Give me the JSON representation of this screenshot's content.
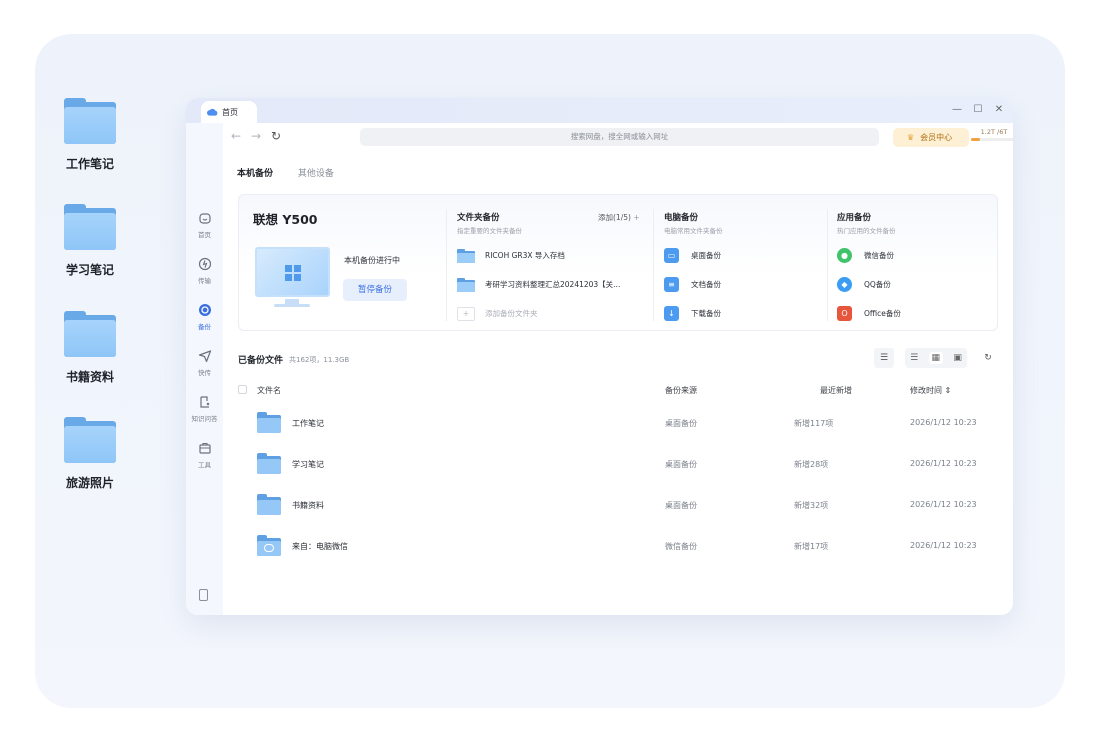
{
  "desktop": {
    "icons": [
      {
        "label": "工作笔记"
      },
      {
        "label": "学习笔记"
      },
      {
        "label": "书籍资料"
      },
      {
        "label": "旅游照片"
      }
    ]
  },
  "window": {
    "tab_title": "首页",
    "controls": {
      "minimize": "—",
      "maximize": "☐",
      "close": "✕"
    },
    "nav": {
      "back": "←",
      "forward": "→",
      "refresh": "↻"
    },
    "search": {
      "placeholder": "搜索网盘，搜全网或输入网址"
    },
    "vip": {
      "label": "会员中心"
    },
    "quota": {
      "text": "1.2T /6T",
      "used_fraction": 0.2
    }
  },
  "sidebar": {
    "items": [
      {
        "label": "首页",
        "icon": "home-icon"
      },
      {
        "label": "传输",
        "icon": "transfer-icon"
      },
      {
        "label": "备份",
        "icon": "backup-icon",
        "active": true
      },
      {
        "label": "快传",
        "icon": "send-icon"
      },
      {
        "label": "知识问答",
        "icon": "qa-icon"
      },
      {
        "label": "工具",
        "icon": "toolbox-icon"
      }
    ]
  },
  "tabs": {
    "active": "本机备份",
    "other": "其他设备"
  },
  "backup_card": {
    "device": "联想 Y500",
    "status": "本机备份进行中",
    "pause_button": "暂停备份",
    "folder_backup": {
      "title": "文件夹备份",
      "subtitle": "指定重要的文件夹备份",
      "add_label": "添加(1/5)",
      "items": [
        "RICOH GR3X 导入存档",
        "考研学习资料整理汇总20241203【关..."
      ],
      "add_placeholder": "添加备份文件夹"
    },
    "pc_backup": {
      "title": "电脑备份",
      "subtitle": "电脑常用文件夹备份",
      "items": [
        "桌面备份",
        "文档备份",
        "下载备份"
      ]
    },
    "app_backup": {
      "title": "应用备份",
      "subtitle": "热门应用的文件备份",
      "items": [
        "微信备份",
        "QQ备份",
        "Office备份"
      ]
    }
  },
  "file_list": {
    "title": "已备份文件",
    "count": "共162项，11.3GB",
    "columns": {
      "name": "文件名",
      "source": "备份来源",
      "recent": "最近新增",
      "modified": "修改时间"
    },
    "rows": [
      {
        "name": "工作笔记",
        "source": "桌面备份",
        "recent": "新增117项",
        "modified": "2026/1/12 10:23"
      },
      {
        "name": "学习笔记",
        "source": "桌面备份",
        "recent": "新增28项",
        "modified": "2026/1/12 10:23"
      },
      {
        "name": "书籍资料",
        "source": "桌面备份",
        "recent": "新增32项",
        "modified": "2026/1/12 10:23"
      },
      {
        "name": "来自：电脑微信",
        "source": "微信备份",
        "recent": "新增17项",
        "modified": "2026/1/12 10:23"
      }
    ]
  },
  "colors": {
    "accent": "#3a6fe0",
    "folder": "#95c8f6",
    "vip_bg": "#fdf0d4"
  }
}
